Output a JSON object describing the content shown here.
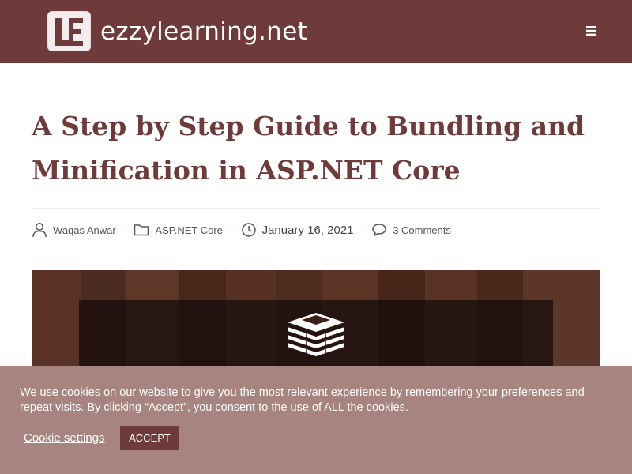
{
  "header": {
    "site_name": "ezzylearning.net",
    "menu_icon": "hamburger-menu-icon"
  },
  "article": {
    "title": "A Step by Step Guide to Bundling and Minification in ASP.NET Core",
    "meta": {
      "author": "Waqas Anwar",
      "category": "ASP.NET Core",
      "date": "January 16, 2021",
      "comments": "3 Comments",
      "separator": "-"
    }
  },
  "cookie_banner": {
    "message": "We use cookies on our website to give you the most relevant experience by remembering your preferences and repeat visits. By clicking “Accept”, you consent to the use of ALL the cookies.",
    "settings_label": "Cookie settings",
    "accept_label": "ACCEPT"
  },
  "colors": {
    "brand": "#6e3a3a",
    "cookie_bg": "#a88480",
    "title": "#6e3a3a"
  }
}
